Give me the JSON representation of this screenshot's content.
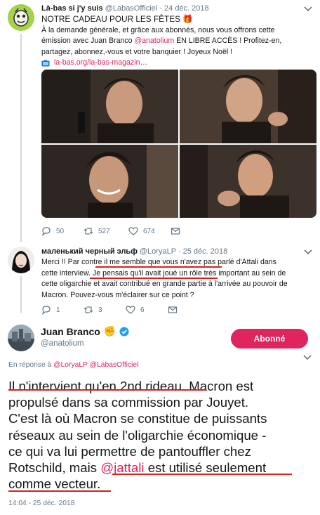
{
  "tweet1": {
    "name": "Là-bas si j'y suis",
    "handle": "@LabasOfficiel",
    "date": "24 déc. 2018",
    "line1": "NOTRE CADEAU POUR LES FÊTES 🎁",
    "line2": "À la demande générale, et grâce aux abonnés, nous vous offrons cette",
    "line3_pre": "émission avec Juan Branco ",
    "line3_mention": "@anatolium",
    "line3_post": " EN LIBRE ACCÈS ! Profitez-en,",
    "line4": "partagez, abonnez,-vous et votre banquier ! Joyeux Noël !",
    "link": "la-bas.org/la-bas-magazin…",
    "replies": "50",
    "retweets": "527",
    "likes": "674"
  },
  "tweet2": {
    "name": "маленький черный эльф",
    "handle": "@LoryaLP",
    "date": "25 déc. 2018",
    "line1": "Merci !! Par contre il me semble que vous n'avez pas parlé d'Attali dans",
    "line2": "cette interview. Je pensais qu'il avait joué un rôle très important au sein de",
    "line3": "cette oligarchie et avait contribué en grande partie à l'arrivée au pouvoir de",
    "line4": "Macron. Pouvez-vous m'éclairer sur ce point ?",
    "replies": "1",
    "retweets": "3",
    "likes": "6"
  },
  "tweet3": {
    "name": "Juan Branco",
    "emoji": "✊",
    "handle": "@anatolium",
    "follow_label": "Abonné",
    "reply_prefix": "En réponse à ",
    "reply_to1": "@LoryaLP",
    "reply_to2": "@LabasOfficiel",
    "line1": "Il n'intervient qu'en 2nd rideau. Macron est",
    "line2": "propulsé dans sa commission par Jouyet.",
    "line3": "C'est là où Macron se constitue de puissants",
    "line4": "réseaux au sein de l'oligarchie économique -",
    "line5": "ce qui va lui permettre de pantouffler chez",
    "line6_pre": "Rotschild, mais ",
    "line6_mention": "@jattali",
    "line6_post": " est utilisé seulement",
    "line7": "comme vecteur.",
    "timestamp": "14:04 - 25 déc. 2018"
  },
  "colors": {
    "accent": "#e0245e",
    "underline": "#d4241c",
    "verified": "#1da1f2",
    "muted": "#657786"
  }
}
